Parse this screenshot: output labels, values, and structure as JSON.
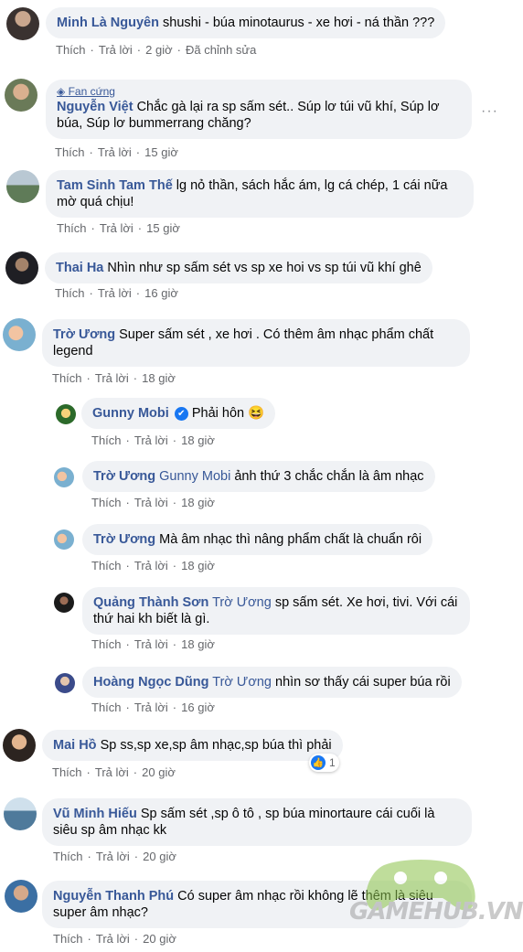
{
  "comments": [
    {
      "name": "Minh Là Nguyên",
      "text": "shushi - búa minotaurus - xe hơi - ná thần ???",
      "like": "Thích",
      "reply": "Trả lời",
      "time": "2 giờ",
      "extra": "Đã chỉnh sửa"
    },
    {
      "badge": "Fan cứng",
      "name": "Nguyễn Việt",
      "text": "Chắc gà lại ra sp sấm sét.. Súp lơ túi vũ khí, Súp lơ búa, Súp lơ bummerrang chăng?",
      "like": "Thích",
      "reply": "Trả lời",
      "time": "15 giờ",
      "more": "···"
    },
    {
      "name": "Tam Sinh Tam Thế",
      "text": "lg nỏ thần, sách hắc ám, lg cá chép, 1 cái nữa mờ quá chịu!",
      "like": "Thích",
      "reply": "Trả lời",
      "time": "15 giờ"
    },
    {
      "name": "Thai Ha",
      "text": "Nhìn như sp sấm sét vs sp xe hoi vs sp túi vũ khí ghê",
      "like": "Thích",
      "reply": "Trả lời",
      "time": "16 giờ"
    },
    {
      "name": "Trờ Ương",
      "text": "Super sấm sét , xe hơi . Có thêm âm nhạc phẩm chất legend",
      "like": "Thích",
      "reply": "Trả lời",
      "time": "18 giờ"
    },
    {
      "name": "Gunny Mobi",
      "text": "Phải hôn 😆",
      "like": "Thích",
      "reply": "Trả lời",
      "time": "18 giờ",
      "verified": "✔"
    },
    {
      "name": "Trờ Ương",
      "tag": "Gunny Mobi",
      "text": "ảnh thứ 3 chắc chắn là âm nhạc",
      "like": "Thích",
      "reply": "Trả lời",
      "time": "18 giờ"
    },
    {
      "name": "Trờ Ương",
      "text": "Mà âm nhạc thì nâng phẩm chất là chuẩn rôi",
      "like": "Thích",
      "reply": "Trả lời",
      "time": "18 giờ"
    },
    {
      "name": "Quảng Thành Sơn",
      "tag": "Trờ Ương",
      "text": "sp sấm sét. Xe hơi, tivi. Với cái thứ hai kh biết là gì.",
      "like": "Thích",
      "reply": "Trả lời",
      "time": "18 giờ"
    },
    {
      "name": "Hoàng Ngọc Dũng",
      "tag": "Trờ Ương",
      "text": "nhìn sơ thấy cái super búa rồi",
      "like": "Thích",
      "reply": "Trả lời",
      "time": "16 giờ"
    },
    {
      "name": "Mai Hồ",
      "text": "Sp ss,sp xe,sp âm nhạc,sp búa thì phải",
      "like": "Thích",
      "reply": "Trả lời",
      "time": "20 giờ",
      "reactions": "1"
    },
    {
      "name": "Vũ Minh Hiếu",
      "text": "Sp sấm sét ,sp ô tô , sp búa minortaure cái cuối là siêu sp âm nhạc kk",
      "like": "Thích",
      "reply": "Trả lời",
      "time": "20 giờ"
    },
    {
      "name": "Nguyễn Thanh Phú",
      "text": "Có super âm nhạc rồi không lẽ thêm là siêu super âm nhạc?",
      "like": "Thích",
      "reply": "Trả lời",
      "time": "20 giờ"
    }
  ],
  "watermark": "GAMEHUB.VN",
  "colors": {
    "link": "#385898",
    "bubble": "#f0f2f5",
    "meta": "#65676b",
    "like": "#1877f2"
  }
}
